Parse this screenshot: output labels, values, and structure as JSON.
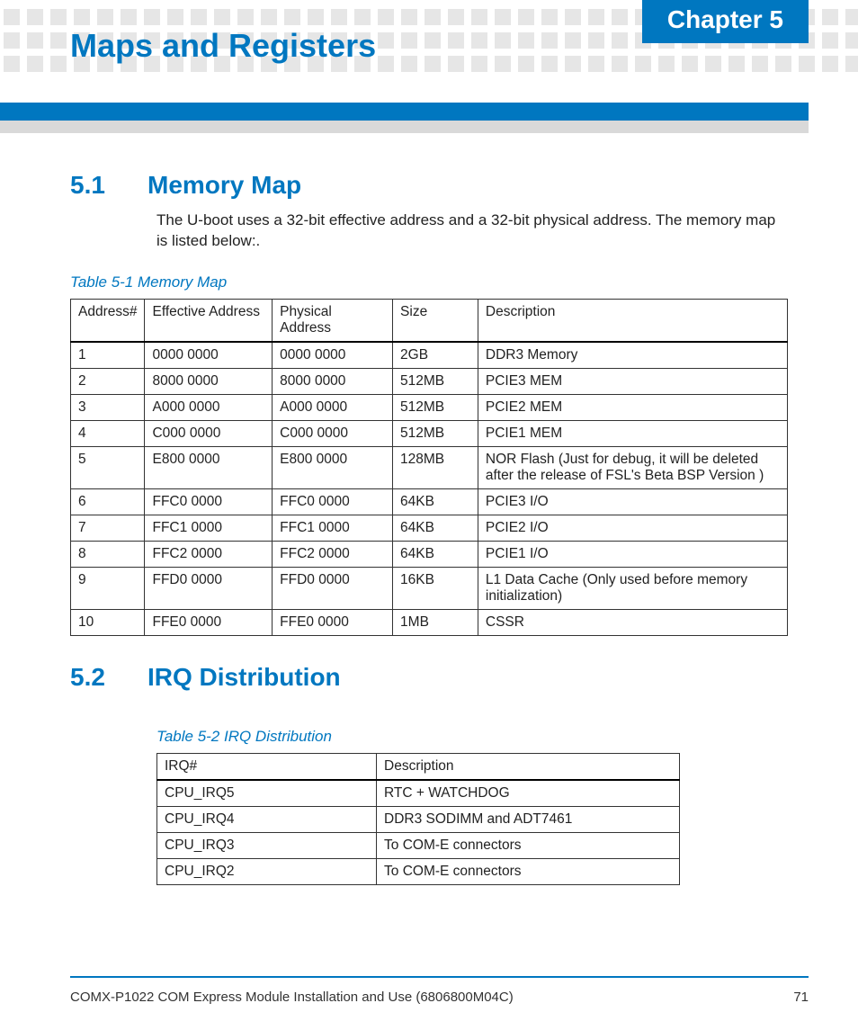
{
  "header": {
    "chapter_badge": "Chapter 5",
    "chapter_title": "Maps and Registers"
  },
  "section1": {
    "num": "5.1",
    "title": "Memory Map",
    "body": "The U-boot uses a 32-bit effective address and a 32-bit physical address. The memory map is listed below:.",
    "table_caption": "Table 5-1 Memory Map",
    "headers": [
      "Address#",
      "Effective Address",
      "Physical Address",
      "Size",
      "Description"
    ],
    "rows": [
      [
        "1",
        "0000 0000",
        " 0000 0000",
        "2GB",
        "DDR3 Memory"
      ],
      [
        "2",
        "8000 0000",
        "8000 0000",
        "512MB",
        "PCIE3 MEM"
      ],
      [
        "3",
        "A000 0000",
        "A000 0000",
        "512MB",
        "PCIE2 MEM"
      ],
      [
        "4",
        "C000 0000",
        "C000 0000",
        "512MB",
        "PCIE1 MEM"
      ],
      [
        "5",
        "E800 0000",
        "E800 0000",
        "128MB",
        "NOR Flash (Just for debug, it will be deleted after the release of FSL's Beta BSP Version )"
      ],
      [
        "6",
        "FFC0 0000",
        "FFC0 0000",
        "64KB",
        "PCIE3 I/O"
      ],
      [
        "7",
        "FFC1 0000",
        "FFC1 0000",
        "64KB",
        "PCIE2 I/O"
      ],
      [
        "8",
        "FFC2 0000",
        "FFC2 0000",
        "64KB",
        "PCIE1 I/O"
      ],
      [
        "9",
        "FFD0 0000",
        "FFD0 0000",
        "16KB",
        "L1 Data Cache (Only used before memory initialization)"
      ],
      [
        "10",
        "FFE0 0000",
        "FFE0 0000",
        "1MB",
        "CSSR"
      ]
    ]
  },
  "section2": {
    "num": "5.2",
    "title": "IRQ Distribution",
    "table_caption": "Table 5-2 IRQ Distribution",
    "headers": [
      "IRQ#",
      "Description"
    ],
    "rows": [
      [
        "CPU_IRQ5",
        "RTC + WATCHDOG"
      ],
      [
        "CPU_IRQ4",
        "DDR3 SODIMM and ADT7461"
      ],
      [
        "CPU_IRQ3",
        "To COM-E connectors"
      ],
      [
        "CPU_IRQ2",
        "To COM-E connectors"
      ]
    ]
  },
  "footer": {
    "doc": "COMX-P1022 COM Express Module Installation and Use (6806800M04C)",
    "page": "71"
  }
}
